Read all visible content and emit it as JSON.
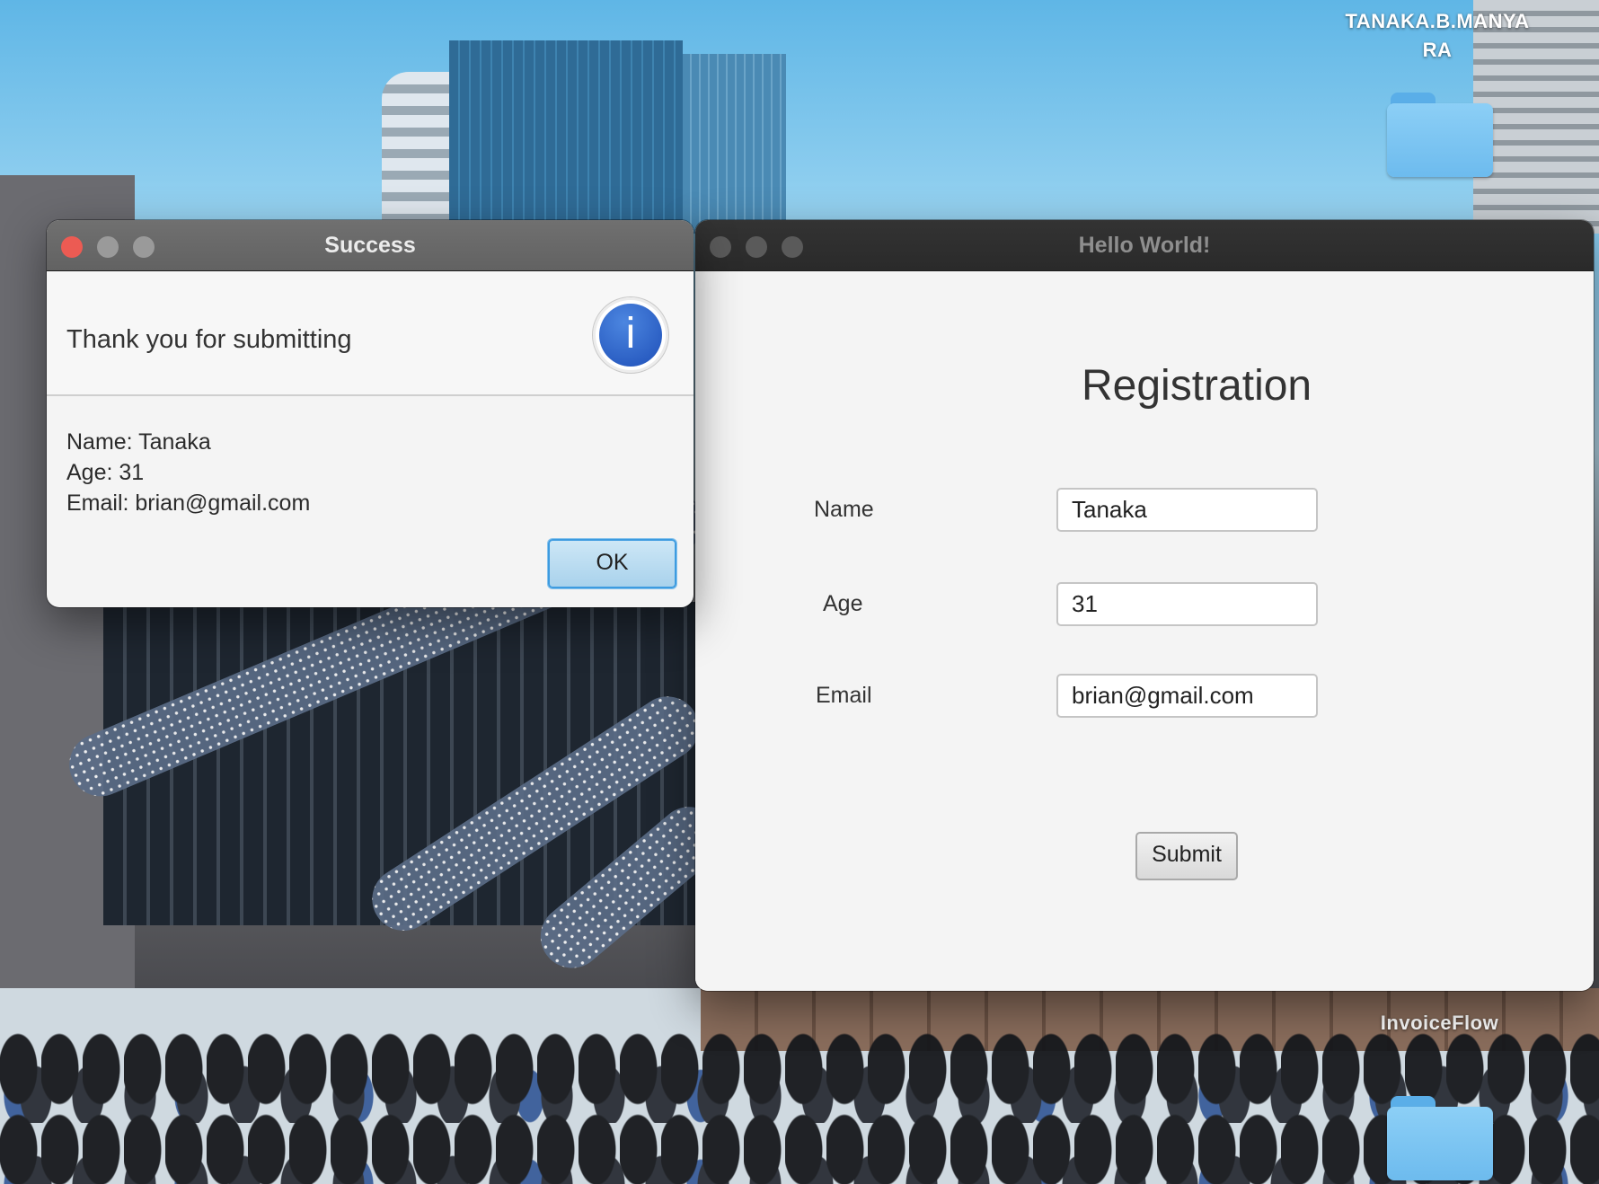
{
  "desktop": {
    "user_label": "TANAKA.B.MANYA RA",
    "folder_icon": "folder-icon",
    "invoice_label": "InvoiceFlow"
  },
  "success_dialog": {
    "title": "Success",
    "message": "Thank you for submitting",
    "info_icon": "info-icon",
    "info_glyph": "i",
    "details": [
      "Name: Tanaka",
      "Age: 31",
      "Email: brian@gmail.com"
    ],
    "ok_label": "OK"
  },
  "hello_window": {
    "title": "Hello World!",
    "heading": "Registration",
    "fields": {
      "name": {
        "label": "Name",
        "value": "Tanaka"
      },
      "age": {
        "label": "Age",
        "value": "31"
      },
      "email": {
        "label": "Email",
        "value": "brian@gmail.com"
      }
    },
    "submit_label": "Submit"
  },
  "colors": {
    "close_button": "#ec5b53",
    "ok_button_border": "#3d9be0",
    "info_icon_fill": "#1e4fb8"
  }
}
